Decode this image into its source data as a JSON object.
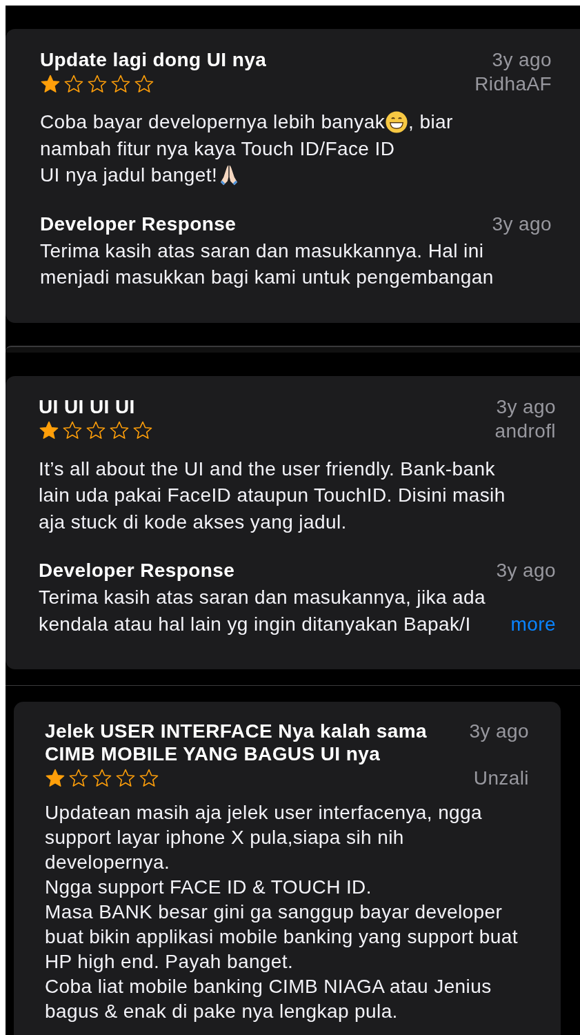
{
  "reviews": [
    {
      "title": "Update lagi dong UI nya",
      "date": "3y ago",
      "author": "RidhaAF",
      "stars": 1,
      "body": [
        [
          {
            "kind": "text",
            "text": "Coba bayar developernya lebih banyak"
          },
          {
            "kind": "grin"
          },
          {
            "kind": "text",
            "text": ", biar"
          }
        ],
        [
          {
            "kind": "text",
            "text": "nambah fitur nya kaya Touch ID/Face ID"
          }
        ],
        [
          {
            "kind": "text",
            "text": "UI nya jadul banget!"
          },
          {
            "kind": "pray"
          }
        ]
      ],
      "response": {
        "label": "Developer Response",
        "date": "3y ago",
        "lines": [
          "Terima kasih atas saran dan masukkannya. Hal ini",
          "menjadi masukkan bagi kami untuk pengembangan"
        ]
      }
    },
    {
      "title": "UI UI UI UI",
      "date": "3y ago",
      "author": "androfl",
      "stars": 1,
      "body": [
        [
          {
            "kind": "text",
            "text": "It’s all about the UI and the user friendly. Bank-bank"
          }
        ],
        [
          {
            "kind": "text",
            "text": "lain uda pakai FaceID ataupun TouchID. Disini masih"
          }
        ],
        [
          {
            "kind": "text",
            "text": "aja stuck di kode akses yang jadul."
          }
        ]
      ],
      "response": {
        "label": "Developer Response",
        "date": "3y ago",
        "lines": [
          "Terima kasih atas saran dan masukannya, jika ada",
          "kendala atau hal lain yg ingin ditanyakan Bapak/I"
        ],
        "more": "more"
      }
    },
    {
      "title": "Jelek USER INTERFACE Nya kalah sama CIMB MOBILE YANG BAGUS UI nya",
      "date": "3y ago",
      "author": "Unzali",
      "stars": 1,
      "body": [
        [
          {
            "kind": "text",
            "text": "Updatean masih aja jelek user interfacenya, ngga"
          }
        ],
        [
          {
            "kind": "text",
            "text": "support layar iphone X pula,siapa sih nih"
          }
        ],
        [
          {
            "kind": "text",
            "text": "developernya."
          }
        ],
        [
          {
            "kind": "text",
            "text": "Ngga support FACE ID & TOUCH ID."
          }
        ],
        [
          {
            "kind": "text",
            "text": "Masa BANK besar gini ga sanggup bayar developer"
          }
        ],
        [
          {
            "kind": "text",
            "text": "buat bikin applikasi mobile banking yang support buat"
          }
        ],
        [
          {
            "kind": "text",
            "text": "HP high end. Payah banget."
          }
        ],
        [
          {
            "kind": "text",
            "text": "Coba liat mobile banking CIMB NIAGA atau Jenius"
          }
        ],
        [
          {
            "kind": "text",
            "text": "bagus & enak di pake nya lengkap pula."
          }
        ]
      ]
    }
  ]
}
